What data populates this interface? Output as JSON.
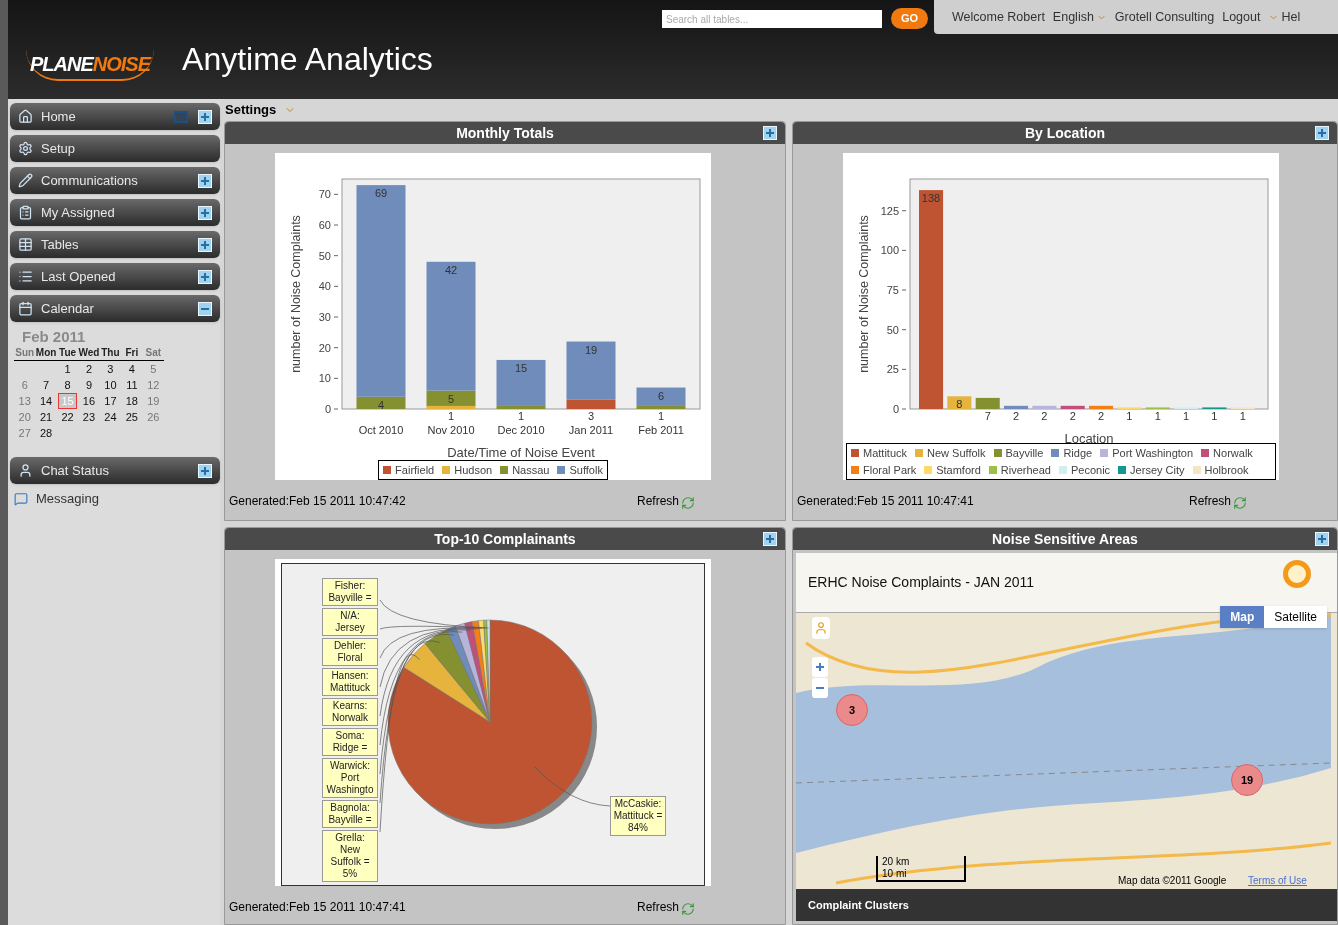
{
  "header": {
    "logo": {
      "part1": "PLANE",
      "part2": "NOISE"
    },
    "title": "Anytime Analytics",
    "search": {
      "placeholder": "Search all tables..."
    },
    "go_button": "GO",
    "links": [
      {
        "label": "Welcome Robert",
        "caret": false
      },
      {
        "label": "English",
        "caret": true
      },
      {
        "label": "Grotell Consulting",
        "caret": false
      },
      {
        "label": "Logout",
        "caret": false
      },
      {
        "label": "Hel",
        "caret": true
      }
    ]
  },
  "sidebar": {
    "items": [
      {
        "label": "Home",
        "expandable": true,
        "expanded": false,
        "restore": true
      },
      {
        "label": "Setup",
        "expandable": false,
        "restore": false
      },
      {
        "label": "Communications",
        "expandable": true,
        "expanded": false,
        "restore": false
      },
      {
        "label": "My Assigned",
        "expandable": true,
        "expanded": false,
        "restore": false
      },
      {
        "label": "Tables",
        "expandable": true,
        "expanded": false,
        "restore": false
      },
      {
        "label": "Last Opened",
        "expandable": true,
        "expanded": false,
        "restore": false
      },
      {
        "label": "Calendar",
        "expandable": true,
        "expanded": true,
        "restore": false
      }
    ],
    "calendar": {
      "month": "Feb 2011",
      "weekdays": [
        "Sun",
        "Mon",
        "Tue",
        "Wed",
        "Thu",
        "Fri",
        "Sat"
      ],
      "weeks": [
        [
          {
            "d": "1",
            "selected": false
          },
          {
            "d": "2",
            "selected": false
          },
          {
            "d": "3",
            "selected": false
          },
          {
            "d": "4",
            "selected": false
          },
          {
            "d": "5",
            "selected": false
          }
        ],
        [
          {
            "d": "6",
            "selected": false
          },
          {
            "d": "7",
            "selected": false
          },
          {
            "d": "8",
            "selected": false
          },
          {
            "d": "9",
            "selected": false
          },
          {
            "d": "10",
            "selected": false
          },
          {
            "d": "11",
            "selected": false
          },
          {
            "d": "12",
            "selected": false
          }
        ],
        [
          {
            "d": "13",
            "selected": false
          },
          {
            "d": "14",
            "selected": false
          },
          {
            "d": "15",
            "selected": true
          },
          {
            "d": "16",
            "selected": false
          },
          {
            "d": "17",
            "selected": false
          },
          {
            "d": "18",
            "selected": false
          },
          {
            "d": "19",
            "selected": false
          }
        ],
        [
          {
            "d": "20",
            "selected": false
          },
          {
            "d": "21",
            "selected": false
          },
          {
            "d": "22",
            "selected": false
          },
          {
            "d": "23",
            "selected": false
          },
          {
            "d": "24",
            "selected": false
          },
          {
            "d": "25",
            "selected": false
          },
          {
            "d": "26",
            "selected": false
          }
        ],
        [
          {
            "d": "27",
            "selected": false
          },
          {
            "d": "28",
            "selected": false
          }
        ]
      ]
    },
    "chat": {
      "label": "Chat Status",
      "expandable": true,
      "expanded": false
    },
    "messaging": "Messaging"
  },
  "settings": "Settings",
  "panels": [
    {
      "kind": "bar",
      "title": "Monthly Totals",
      "generated": "Generated:Feb 15 2011 10:47:42",
      "refresh": "Refresh",
      "chart_data": {
        "type": "bar",
        "stacked": true,
        "xlabel": "Date/Time of Noise Event",
        "ylabel": "number of Noise Complaints",
        "categories": [
          "Oct 2010",
          "Nov 2010",
          "Dec 2010",
          "Jan 2011",
          "Feb 2011"
        ],
        "ylim": [
          0,
          75
        ],
        "yticks": [
          0,
          10,
          20,
          30,
          40,
          50,
          60,
          70
        ],
        "data_labels": true,
        "series": [
          {
            "name": "Fairfield",
            "color": "#bf5433",
            "values": [
              null,
              null,
              null,
              3,
              null
            ]
          },
          {
            "name": "Hudson",
            "color": "#e6b33c",
            "values": [
              null,
              1,
              null,
              null,
              null
            ]
          },
          {
            "name": "Nassau",
            "color": "#859130",
            "values": [
              4,
              5,
              1,
              null,
              1
            ]
          },
          {
            "name": "Suffolk",
            "color": "#6f8cbb",
            "values": [
              69,
              42,
              15,
              19,
              6
            ]
          }
        ]
      }
    },
    {
      "kind": "bar",
      "title": "By Location",
      "generated": "Generated:Feb 15 2011 10:47:41",
      "refresh": "Refresh",
      "chart_data": {
        "type": "bar",
        "xlabel": "Location",
        "ylabel": "number of Noise Complaints",
        "ylim": [
          0,
          145
        ],
        "yticks": [
          0,
          25,
          50,
          75,
          100,
          125
        ],
        "data_labels": true,
        "series": [
          {
            "name": "Mattituck",
            "color": "#bf5433",
            "values": [
              138
            ]
          },
          {
            "name": "New Suffolk",
            "color": "#e6b33c",
            "values": [
              8
            ]
          },
          {
            "name": "Bayville",
            "color": "#859130",
            "values": [
              7
            ]
          },
          {
            "name": "Ridge",
            "color": "#6f8cbb",
            "values": [
              2
            ]
          },
          {
            "name": "Port Washington",
            "color": "#b8b5dc",
            "values": [
              2
            ]
          },
          {
            "name": "Norwalk",
            "color": "#c0507a",
            "values": [
              2
            ]
          },
          {
            "name": "Floral Park",
            "color": "#f57f17",
            "values": [
              2
            ]
          },
          {
            "name": "Stamford",
            "color": "#fbd96a",
            "values": [
              1
            ]
          },
          {
            "name": "Riverhead",
            "color": "#9ebe4a",
            "values": [
              1
            ]
          },
          {
            "name": "Peconic",
            "color": "#d3eeee",
            "values": [
              1
            ]
          },
          {
            "name": "Jersey City",
            "color": "#16978e",
            "values": [
              1
            ]
          },
          {
            "name": "Holbrook",
            "color": "#f3e6c8",
            "values": [
              1
            ]
          }
        ]
      }
    },
    {
      "kind": "pie",
      "title": "Top-10 Complainants",
      "generated": "Generated:Feb 15 2011 10:47:41",
      "refresh": "Refresh",
      "callouts": [
        "Fisher: Bayville =",
        "N/A: Jersey",
        "Dehler: Floral",
        "Hansen: Mattituck",
        "Kearns: Norwalk",
        "Soma: Ridge =",
        "Warwick: Port Washingto",
        "Bagnola: Bayville =",
        "Grella: New Suffolk = 5%",
        "McCaskie: Mattituck = 84%"
      ]
    },
    {
      "kind": "map",
      "title": "Noise Sensitive Areas",
      "map": {
        "title": "ERHC Noise Complaints - JAN 2011",
        "types": [
          {
            "label": "Map",
            "selected": true
          },
          {
            "label": "Satellite",
            "selected": false
          }
        ],
        "markers": [
          {
            "count": "3"
          },
          {
            "count": "19"
          }
        ],
        "scale": [
          "20 km",
          "10 mi"
        ],
        "attribution": "Map data ©2011 Google",
        "terms": "Terms of Use",
        "footer": "Complaint Clusters"
      }
    }
  ]
}
